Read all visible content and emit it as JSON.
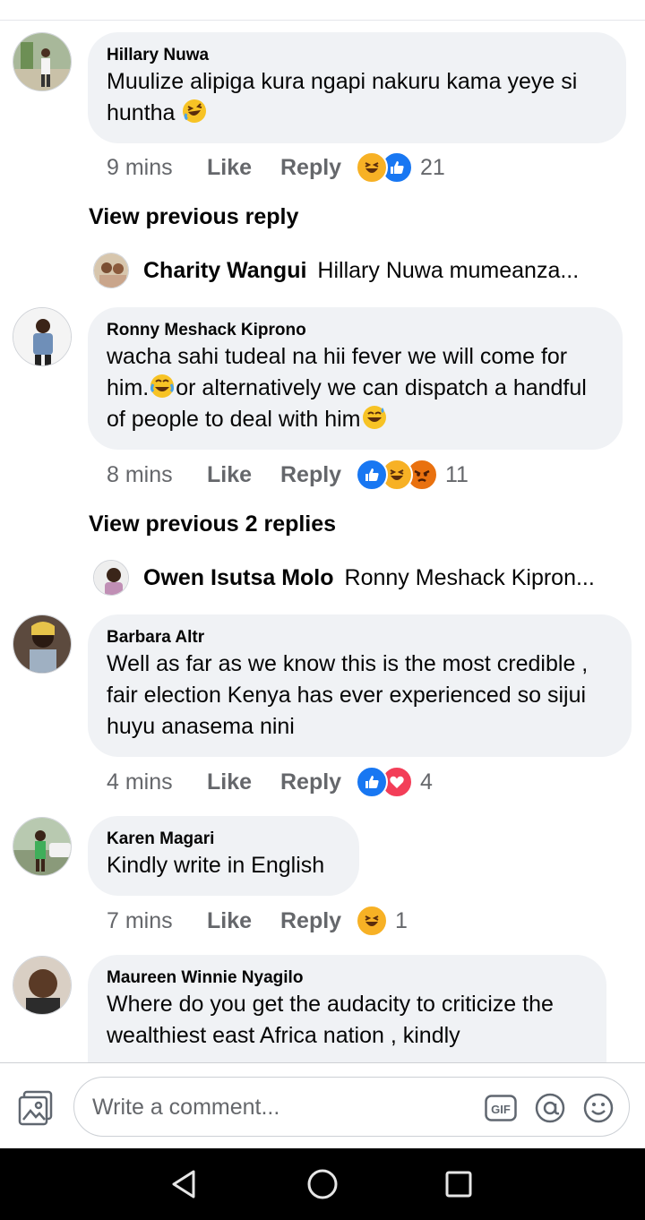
{
  "comments": [
    {
      "author": "Hillary Nuwa",
      "text": "Muulize alipiga kura ngapi nakuru kama yeye si huntha",
      "time": "9 mins",
      "like": "Like",
      "reply": "Reply",
      "reactions": [
        "haha",
        "like"
      ],
      "count": "21"
    },
    {
      "author": "Ronny Meshack Kiprono",
      "text_a": "wacha sahi tudeal na hii fever we will come for him.",
      "text_b": "or alternatively we can dispatch  a handful of people to deal with him",
      "time": "8 mins",
      "like": "Like",
      "reply": "Reply",
      "reactions": [
        "like",
        "haha",
        "angry"
      ],
      "count": "11"
    },
    {
      "author": "Barbara Altr",
      "text": "Well as far as we know this is the most credible , fair election Kenya has ever experienced so sijui huyu anasema nini",
      "time": "4 mins",
      "like": "Like",
      "reply": "Reply",
      "reactions": [
        "like",
        "love"
      ],
      "count": "4"
    },
    {
      "author": "Karen Magari",
      "text": "Kindly write in English",
      "time": "7 mins",
      "like": "Like",
      "reply": "Reply",
      "reactions": [
        "haha"
      ],
      "count": "1"
    },
    {
      "author": "Maureen Winnie Nyagilo",
      "text": "Where do you get the audacity to criticize the wealthiest east Africa nation , kindly"
    }
  ],
  "threads": [
    {
      "view_previous": "View previous reply",
      "reply_author": "Charity Wangui",
      "reply_snippet": "Hillary Nuwa mumeanza..."
    },
    {
      "view_previous": "View previous 2 replies",
      "reply_author": "Owen Isutsa Molo",
      "reply_snippet": "Ronny Meshack Kipron..."
    }
  ],
  "composer": {
    "placeholder": "Write a comment...",
    "gif_label": "GIF"
  },
  "colors": {
    "bubble": "#f0f2f5",
    "secondary_text": "#65676b",
    "like_blue": "#1877f2",
    "love_red": "#f33e58",
    "haha_yellow": "#f7b125"
  }
}
